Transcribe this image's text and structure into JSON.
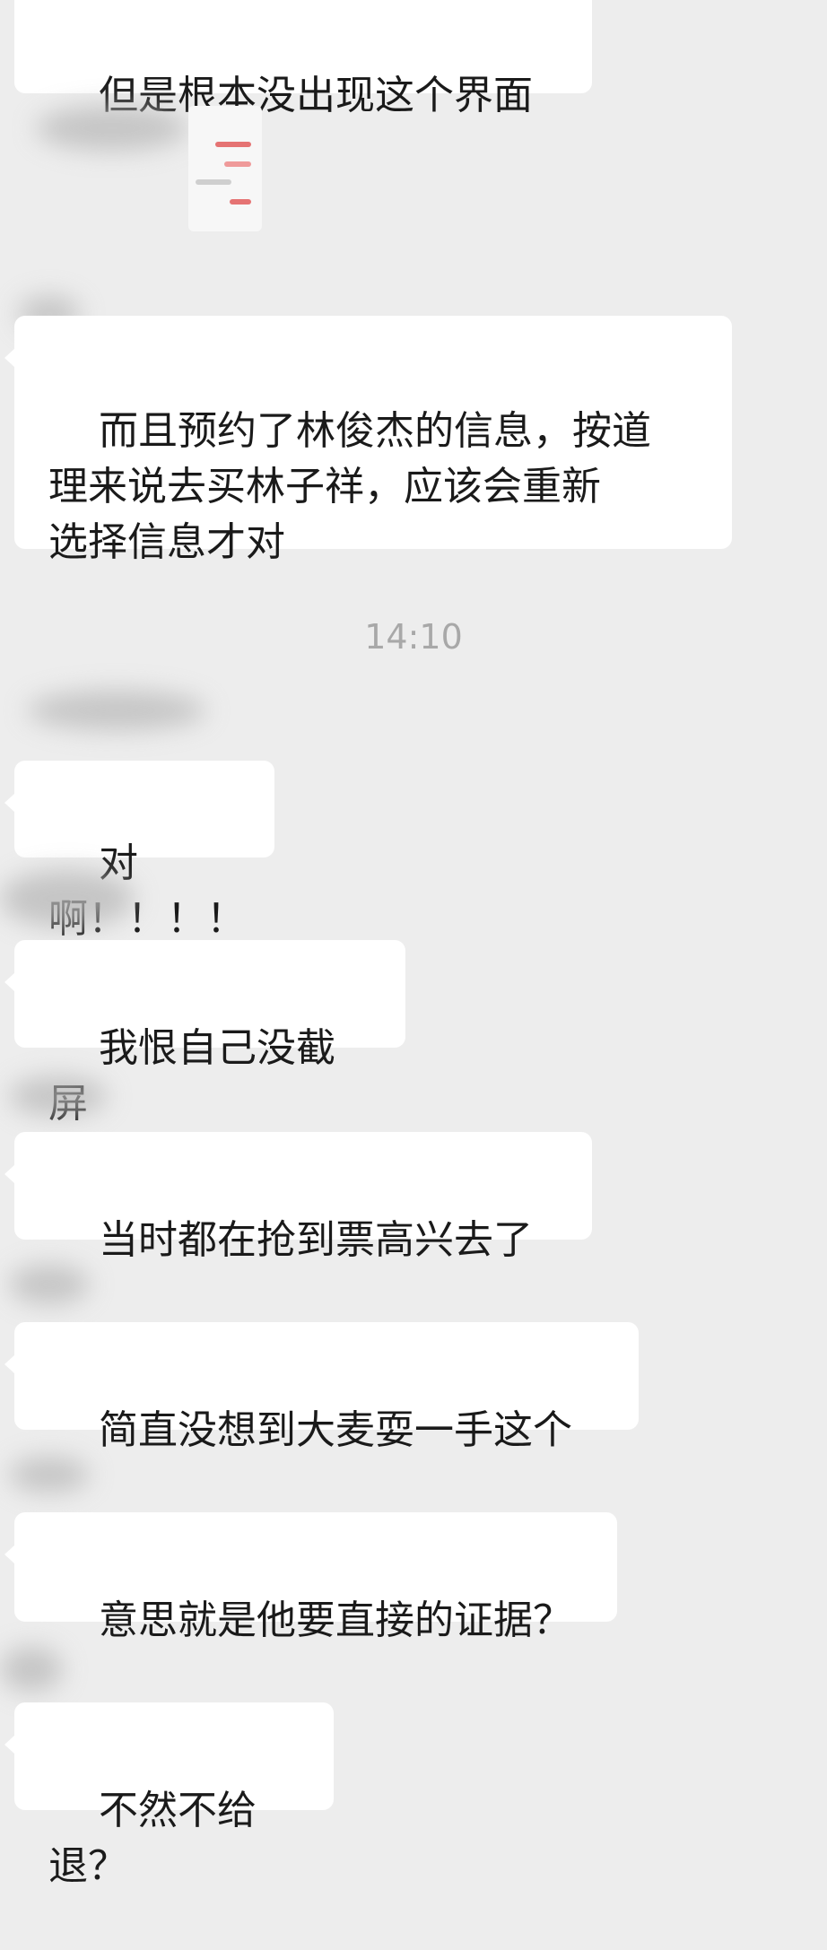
{
  "messages": [
    {
      "text": "但是根本没出现这个界面"
    },
    {
      "text": "而且预约了林俊杰的信息，按道\n理来说去买林子祥，应该会重新\n选择信息才对"
    },
    {
      "text": "对啊！！！！"
    },
    {
      "text": "我恨自己没截屏"
    },
    {
      "text": "当时都在抢到票高兴去了"
    },
    {
      "text": "简直没想到大麦耍一手这个"
    },
    {
      "text": "意思就是他要直接的证据？"
    },
    {
      "text": "不然不给退？"
    }
  ],
  "timestamp": "14:10",
  "colors": {
    "background": "#ededed",
    "bubble": "#ffffff",
    "text": "#1a1a1a",
    "timestamp": "#a8a8a8"
  }
}
